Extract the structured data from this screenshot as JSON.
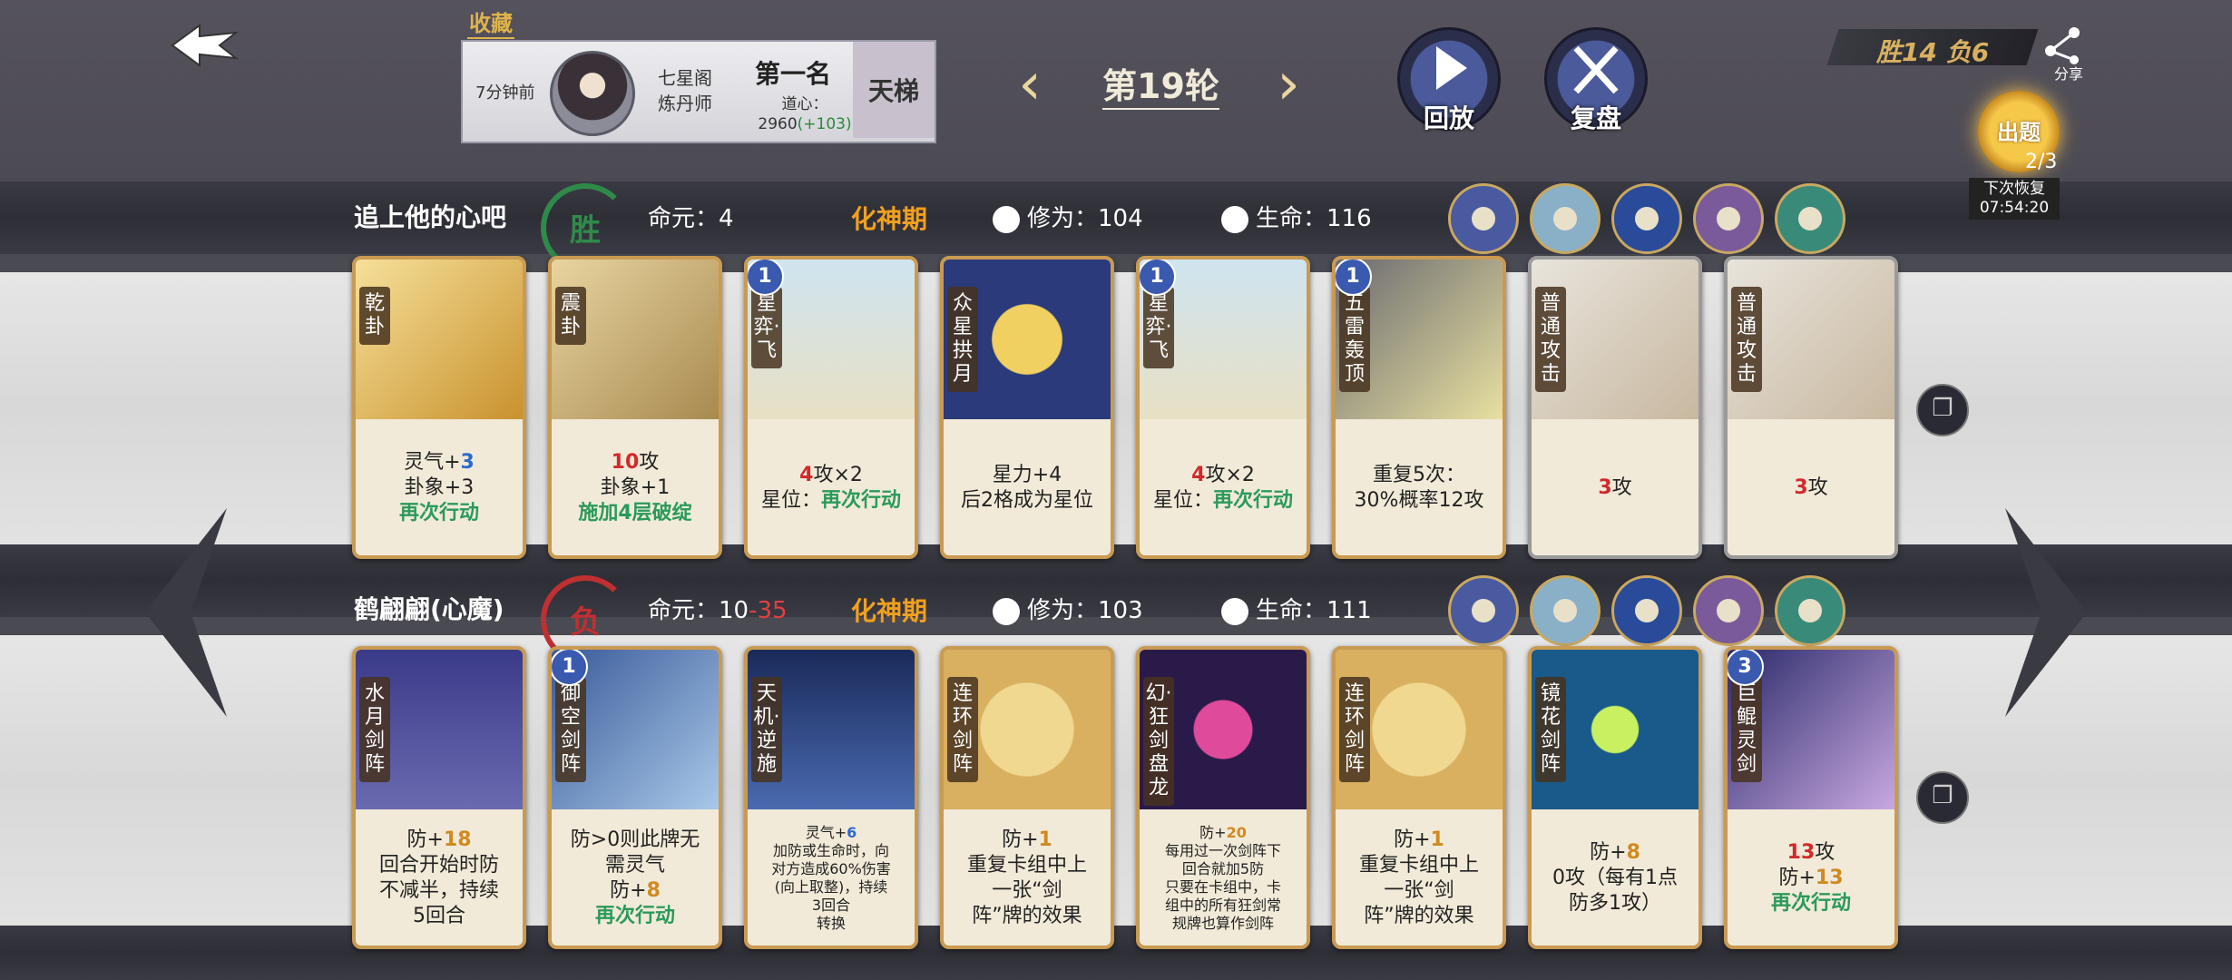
{
  "header": {
    "collect_label": "收藏",
    "time_ago": "7分钟前",
    "sect_line1": "七星阁",
    "sect_line2": "炼丹师",
    "rank": "第一名",
    "dao_label": "道心：",
    "dao_value": "2960",
    "dao_delta": "(+103)",
    "ladder": "天梯",
    "round": "第19轮",
    "replay": "回放",
    "review": "复盘",
    "score": "胜14  负6",
    "share": "分享",
    "chuti": "出题",
    "chuti_count": "2/3",
    "recover_label": "下次恢复",
    "recover_time": "07:54:20"
  },
  "players": [
    {
      "name": "追上他的心吧",
      "result": "胜",
      "result_color": "#2f8a4a",
      "mingyuan_label": "命元：",
      "mingyuan": "4",
      "mingyuan_loss": "",
      "realm": "化神期",
      "cultivation_label": "修为：",
      "cultivation": "104",
      "health_label": "生命：",
      "health": "116",
      "relic_icons": [
        "scroll-relic-icon",
        "waterfall-relic-icon",
        "orb-relic-icon",
        "portrait-relic-icon",
        "gem-relic-icon"
      ],
      "cards": [
        {
          "name": "乾卦",
          "level": "",
          "text_parts": [
            [
              "灵气+",
              ""
            ],
            [
              "3",
              "#2a6ad0"
            ],
            [
              "\n卦象+3",
              ""
            ],
            [
              "\n再次行动",
              "#2a9a5a"
            ]
          ],
          "art": "linear-gradient(135deg,#f6e09a,#c9922e)"
        },
        {
          "name": "震卦",
          "level": "",
          "text_parts": [
            [
              "10",
              "#d02a2a"
            ],
            [
              "攻\n卦象+1",
              ""
            ],
            [
              "\n施加4层破绽",
              "#2a9a5a"
            ]
          ],
          "art": "linear-gradient(135deg,#e8d4a0,#a88a50)"
        },
        {
          "name": "星弈·飞",
          "level": "1",
          "text_parts": [
            [
              "4",
              "#d02a2a"
            ],
            [
              "攻×2\n星位：",
              ""
            ],
            [
              "再次行动",
              "#2a9a5a"
            ]
          ],
          "art": "linear-gradient(180deg,#cfe4f0,#e8e0c4)"
        },
        {
          "name": "众星拱月",
          "level": "",
          "text_parts": [
            [
              "星力+4\n后2格成为星位",
              ""
            ]
          ],
          "art": "radial-gradient(circle,#f0d060 0 30%,#2a3a7a 31%)"
        },
        {
          "name": "星弈·飞",
          "level": "1",
          "text_parts": [
            [
              "4",
              "#d02a2a"
            ],
            [
              "攻×2\n星位：",
              ""
            ],
            [
              "再次行动",
              "#2a9a5a"
            ]
          ],
          "art": "linear-gradient(180deg,#cfe4f0,#e8e0c4)"
        },
        {
          "name": "五雷轰顶",
          "level": "1",
          "text_parts": [
            [
              "重复5次：\n30%概率12攻",
              ""
            ]
          ],
          "art": "linear-gradient(135deg,#6a6a70,#e8e0a0)"
        },
        {
          "name": "普通攻击",
          "level": "",
          "plain": true,
          "text_parts": [
            [
              "3",
              "#d02a2a"
            ],
            [
              "攻",
              ""
            ]
          ],
          "art": "linear-gradient(135deg,#e8e4dc,#c8b8a0)"
        },
        {
          "name": "普通攻击",
          "level": "",
          "plain": true,
          "text_parts": [
            [
              "3",
              "#d02a2a"
            ],
            [
              "攻",
              ""
            ]
          ],
          "art": "linear-gradient(135deg,#e8e4dc,#c8b8a0)"
        }
      ]
    },
    {
      "name": "鹤翩翩(心魔)",
      "result": "负",
      "result_color": "#c03030",
      "mingyuan_label": "命元：",
      "mingyuan": "10",
      "mingyuan_loss": "-35",
      "realm": "化神期",
      "cultivation_label": "修为：",
      "cultivation": "103",
      "health_label": "生命：",
      "health": "111",
      "relic_icons": [
        "eye-relic-icon",
        "lightning-relic-icon",
        "moon-relic-icon",
        "moon-relic-icon",
        "gem-relic-icon"
      ],
      "cards": [
        {
          "name": "水月剑阵",
          "level": "",
          "text_parts": [
            [
              "防+",
              ""
            ],
            [
              "18",
              "#d08a20"
            ],
            [
              "\n回合开始时防\n不减半，持续\n5回合",
              ""
            ]
          ],
          "art": "linear-gradient(180deg,#3a3a8a,#6a6ab0)"
        },
        {
          "name": "御空剑阵",
          "level": "1",
          "text_parts": [
            [
              "防>0则此牌无\n需灵气\n防+",
              ""
            ],
            [
              "8",
              "#d08a20"
            ],
            [
              "\n再次行动",
              "#2a9a5a"
            ]
          ],
          "art": "linear-gradient(135deg,#3a5a9a,#a8c8e8)"
        },
        {
          "name": "天机·逆施",
          "level": "",
          "small": true,
          "text_parts": [
            [
              "灵气+",
              ""
            ],
            [
              "6",
              "#2a6ad0"
            ],
            [
              "\n加防或生命时，向\n对方造成60%伤害\n(向上取整)，持续\n3回合\n转换",
              ""
            ]
          ],
          "art": "linear-gradient(180deg,#1a2a5a,#4a6ab0)"
        },
        {
          "name": "连环剑阵",
          "level": "",
          "text_parts": [
            [
              "防+",
              ""
            ],
            [
              "1",
              "#d08a20"
            ],
            [
              "\n重复卡组中上\n一张“剑\n阵”牌的效果",
              ""
            ]
          ],
          "art": "radial-gradient(circle,#f0d890 0 40%,#d8b060 41%)"
        },
        {
          "name": "幻·狂剑盘龙",
          "level": "",
          "small": true,
          "text_parts": [
            [
              "防+",
              ""
            ],
            [
              "20",
              "#d08a20"
            ],
            [
              "\n每用过一次剑阵下\n回合就加5防\n只要在卡组中，卡\n组中的所有狂剑常\n规牌也算作剑阵",
              ""
            ]
          ],
          "art": "radial-gradient(circle,#e04a9a 0 25%,#2a1a4a 26%)"
        },
        {
          "name": "连环剑阵",
          "level": "",
          "text_parts": [
            [
              "防+",
              ""
            ],
            [
              "1",
              "#d08a20"
            ],
            [
              "\n重复卡组中上\n一张“剑\n阵”牌的效果",
              ""
            ]
          ],
          "art": "radial-gradient(circle,#f0d890 0 40%,#d8b060 41%)"
        },
        {
          "name": "镜花剑阵",
          "level": "",
          "text_parts": [
            [
              "防+",
              ""
            ],
            [
              "8",
              "#d08a20"
            ],
            [
              "\n0攻（每有1点\n防多1攻）",
              ""
            ]
          ],
          "art": "radial-gradient(circle,#c8f060 0 20%,#1a5a8a 21%)"
        },
        {
          "name": "巨鲲灵剑",
          "level": "3",
          "text_parts": [
            [
              "13",
              "#d02a2a"
            ],
            [
              "攻\n防+",
              ""
            ],
            [
              "13",
              "#d08a20"
            ],
            [
              "\n再次行动",
              "#2a9a5a"
            ]
          ],
          "art": "linear-gradient(135deg,#2a2a6a,#c8a8e0)"
        }
      ]
    }
  ]
}
